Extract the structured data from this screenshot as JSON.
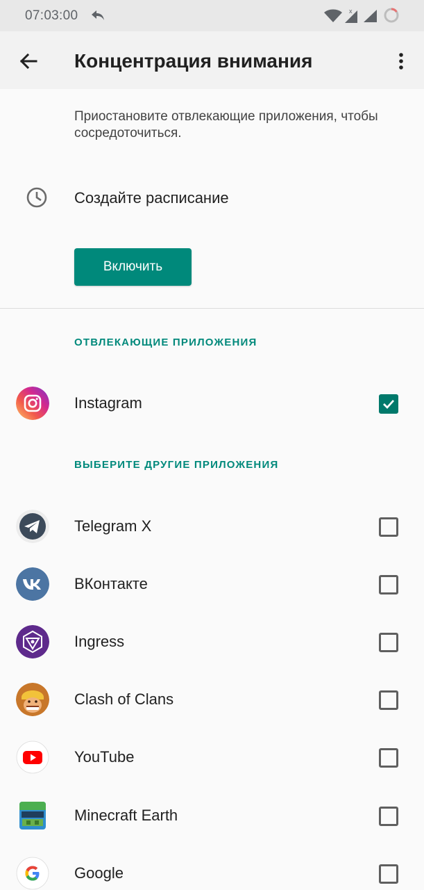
{
  "status_bar": {
    "time": "07:03:00"
  },
  "app_bar": {
    "title": "Концентрация внимания"
  },
  "description": "Приостановите отвлекающие приложения, чтобы сосредоточиться.",
  "schedule": {
    "label": "Создайте расписание",
    "icon": "clock-icon"
  },
  "enable_button": {
    "label": "Включить"
  },
  "colors": {
    "accent": "#00897b",
    "checkbox_checked": "#00796b"
  },
  "distracting_section": {
    "header": "ОТВЛЕКАЮЩИЕ ПРИЛОЖЕНИЯ",
    "apps": [
      {
        "name": "Instagram",
        "icon": "instagram-icon",
        "checked": true
      }
    ]
  },
  "other_section": {
    "header": "ВЫБЕРИТЕ ДРУГИЕ ПРИЛОЖЕНИЯ",
    "apps": [
      {
        "name": "Telegram X",
        "icon": "telegram-x-icon",
        "checked": false
      },
      {
        "name": "ВКонтакте",
        "icon": "vk-icon",
        "checked": false
      },
      {
        "name": "Ingress",
        "icon": "ingress-icon",
        "checked": false
      },
      {
        "name": "Clash of Clans",
        "icon": "clash-of-clans-icon",
        "checked": false
      },
      {
        "name": "YouTube",
        "icon": "youtube-icon",
        "checked": false
      },
      {
        "name": "Minecraft Earth",
        "icon": "minecraft-earth-icon",
        "checked": false
      },
      {
        "name": "Google",
        "icon": "google-icon",
        "checked": false
      }
    ]
  }
}
